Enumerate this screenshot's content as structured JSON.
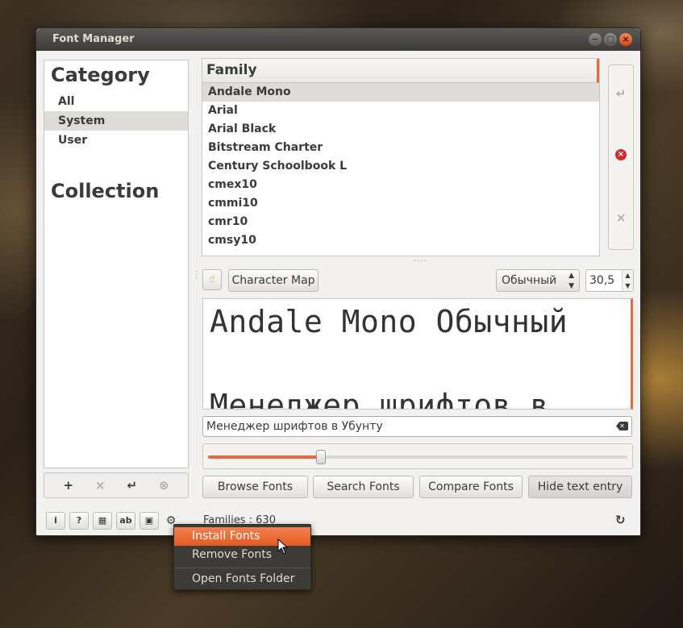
{
  "window": {
    "title": "Font Manager",
    "buttons": {
      "minimize": "−",
      "maximize": "□",
      "close": "×"
    }
  },
  "category_panel": {
    "category_title": "Category",
    "items": [
      {
        "label": "All",
        "selected": false
      },
      {
        "label": "System",
        "selected": true
      },
      {
        "label": "User",
        "selected": false
      }
    ],
    "collection_title": "Collection",
    "actions": {
      "add": "+",
      "remove": "×",
      "apply": "↵",
      "clear": "⊗"
    }
  },
  "family_list": {
    "header": "Family",
    "rows": [
      {
        "label": "Andale Mono",
        "selected": true
      },
      {
        "label": "Arial",
        "selected": false
      },
      {
        "label": "Arial Black",
        "selected": false
      },
      {
        "label": "Bitstream Charter",
        "selected": false
      },
      {
        "label": "Century Schoolbook L",
        "selected": false
      },
      {
        "label": "cmex10",
        "selected": false
      },
      {
        "label": "cmmi10",
        "selected": false
      },
      {
        "label": "cmr10",
        "selected": false
      },
      {
        "label": "cmsy10",
        "selected": false
      }
    ]
  },
  "side_actions": {
    "enable": "↵",
    "delete": "×",
    "remove": "×"
  },
  "toolbar": {
    "character_map_label": "Character Map",
    "style_value": "Обычный",
    "size_value": "30,5"
  },
  "preview": {
    "line1": "Andale Mono Обычный",
    "line2": "Менеджер шрифтов в"
  },
  "preview_entry": {
    "value": "Менеджер шрифтов в Убунту"
  },
  "size_slider": {
    "fraction": 0.27
  },
  "mode_buttons": {
    "browse": "Browse Fonts",
    "search": "Search Fonts",
    "compare": "Compare Fonts",
    "hide_entry": "Hide text entry"
  },
  "status": {
    "families_text": "Families : 630",
    "icons": [
      "info-icon",
      "help-icon",
      "font-info-icon",
      "font-sample-icon",
      "save-icon",
      "gear-icon"
    ]
  },
  "context_menu": {
    "items": [
      {
        "label": "Install Fonts",
        "highlighted": true
      },
      {
        "label": "Remove Fonts",
        "highlighted": false
      },
      {
        "label": "Open Fonts Folder",
        "highlighted": false
      }
    ]
  },
  "colors": {
    "accent": "#e8693b",
    "titlebar": "#3c3b37",
    "window_bg": "#f2f1f0"
  }
}
